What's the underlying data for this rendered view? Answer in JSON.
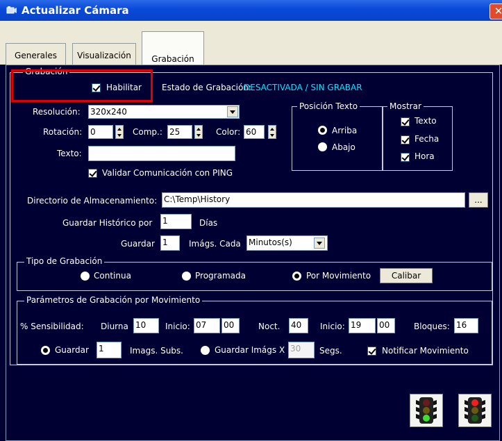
{
  "window": {
    "title": "Actualizar Cámara",
    "close_glyph": "✕"
  },
  "tabs": [
    {
      "label": "Generales",
      "active": false
    },
    {
      "label": "Visualización",
      "active": false
    },
    {
      "label": "Grabación",
      "active": true
    }
  ],
  "grabacion": {
    "legend": "Grabación",
    "enable_label": "Habilitar",
    "enabled": true,
    "state_label": "Estado de Grabación:",
    "state_value": "DESACTIVADA / SIN GRABAR",
    "state_color": "#00e8ff",
    "resolution_label": "Resolución:",
    "resolution_value": "320x240",
    "rotation_label": "Rotación:",
    "rotation_value": "0",
    "comp_label": "Comp.:",
    "comp_value": "25",
    "color_label": "Color:",
    "color_value": "60",
    "text_label": "Texto:",
    "text_value": "",
    "ping_label": "Validar Comunicación con PING",
    "ping_checked": true
  },
  "position_text": {
    "legend": "Posición Texto",
    "options": [
      {
        "label": "Arriba",
        "selected": true
      },
      {
        "label": "Abajo",
        "selected": false
      }
    ]
  },
  "show": {
    "legend": "Mostrar",
    "items": [
      {
        "label": "Texto",
        "checked": true
      },
      {
        "label": "Fecha",
        "checked": true
      },
      {
        "label": "Hora",
        "checked": true
      }
    ]
  },
  "storage": {
    "dir_label": "Directorio de Almacenamiento:",
    "dir_value": "C:\\Temp\\History",
    "browse_label": "...",
    "history_label": "Guardar Histórico por",
    "history_value": "1",
    "history_unit": "Días",
    "save_label": "Guardar",
    "save_value": "1",
    "every_label": "Imágs. Cada",
    "every_value": "Minutos(s)"
  },
  "record_type": {
    "legend": "Tipo de Grabación",
    "options": [
      {
        "label": "Continua",
        "selected": false
      },
      {
        "label": "Programada",
        "selected": false
      },
      {
        "label": "Por Movimiento",
        "selected": true
      }
    ],
    "calibrate_label": "Calibar"
  },
  "motion": {
    "legend": "Parámetros de Grabación por Movimiento",
    "sensitivity_label": "% Sensibilidad:",
    "day_label": "Diurna",
    "day_value": "10",
    "start_label": "Inicio:",
    "day_start_h": "07",
    "day_start_m": "00",
    "night_label": "Noct.",
    "night_value": "40",
    "night_start_label": "Inicio:",
    "night_start_h": "19",
    "night_start_m": "00",
    "blocks_label": "Bloques:",
    "blocks_value": "16",
    "save_label": "Guardar",
    "save_selected": true,
    "save_value": "1",
    "subs_label": "Imags. Subs.",
    "save_x_label": "Guardar Imágs X",
    "save_x_selected": false,
    "save_x_value": "30",
    "secs_label": "Segs.",
    "notify_label": "Notificar Movimiento",
    "notify_checked": true
  },
  "traffic_buttons": [
    {
      "icon": "traffic-light-green-icon"
    },
    {
      "icon": "traffic-light-red-icon"
    }
  ]
}
